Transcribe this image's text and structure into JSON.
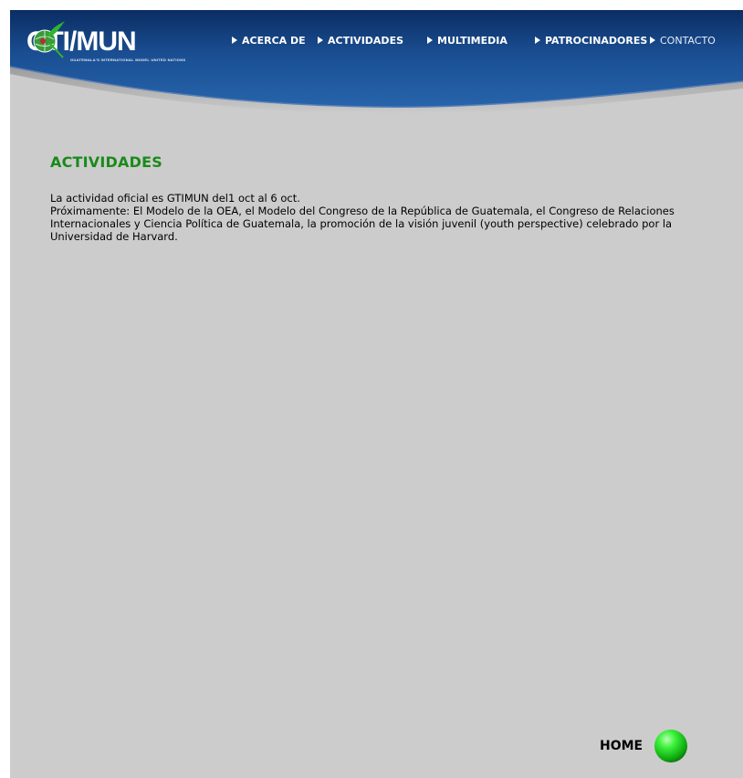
{
  "header": {
    "logo_text": "GTI/MUN",
    "logo_tagline": "GUATEMALA'S INTERNATIONAL MODEL UNITED NATIONS"
  },
  "nav": {
    "items": [
      {
        "label": "ACERCA DE"
      },
      {
        "label": "ACTIVIDADES"
      },
      {
        "label": "MULTIMEDIA"
      },
      {
        "label": "PATROCINADORES"
      },
      {
        "label": "CONTACTO"
      }
    ]
  },
  "main": {
    "title": "ACTIVIDADES",
    "paragraphs": [
      "La actividad oficial es GTIMUN del1 oct al 6 oct.",
      "Próximamente: El Modelo de la OEA, el Modelo del Congreso de la República de Guatemala, el Congreso de Relaciones Internacionales y Ciencia Política de Guatemala, la promoción de la visión juvenil (youth perspective) celebrado por la Universidad de Harvard."
    ]
  },
  "footer": {
    "home_label": "HOME"
  },
  "colors": {
    "header_blue": "#1b4f8f",
    "header_dark": "#0a2a5a",
    "title_green": "#1a8a1a",
    "page_gray": "#cccccc",
    "home_green": "#22dd22"
  },
  "icons": {
    "logo_globe": "globe-bird-icon",
    "nav_arrow": "triangle-right-icon",
    "home_ball": "green-sphere-icon"
  }
}
